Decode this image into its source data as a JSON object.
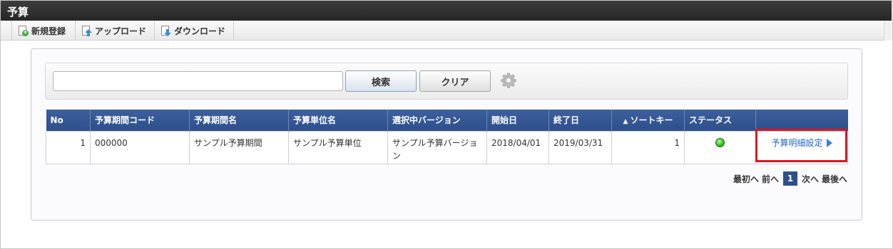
{
  "app": {
    "title": "予算"
  },
  "toolbar": {
    "new_label": "新規登録",
    "upload_label": "アップロード",
    "download_label": "ダウンロード"
  },
  "search": {
    "value": "",
    "placeholder": "",
    "search_label": "検索",
    "clear_label": "クリア"
  },
  "table": {
    "columns": [
      "No",
      "予算期間コード",
      "予算期間名",
      "予算単位名",
      "選択中バージョン",
      "開始日",
      "終了日",
      "ソートキー",
      "ステータス",
      ""
    ],
    "sort_indicator": "▲",
    "rows": [
      {
        "no": "1",
        "period_code": "000000",
        "period_name": "サンプル予算期間",
        "unit_name": "サンプル予算単位",
        "version": "サンプル予算バージョン",
        "start_date": "2018/04/01",
        "end_date": "2019/03/31",
        "sort_key": "1",
        "status": "active",
        "action_label": "予算明細設定"
      }
    ]
  },
  "pager": {
    "first": "最初へ",
    "prev": "前へ",
    "current": "1",
    "next": "次へ",
    "last": "最後へ"
  },
  "colors": {
    "header_bg": "#2d4f8c",
    "titlebar_bg": "#2f2f2f",
    "status_ok": "#35c21e",
    "highlight": "#e0141e",
    "link": "#2266cc"
  }
}
